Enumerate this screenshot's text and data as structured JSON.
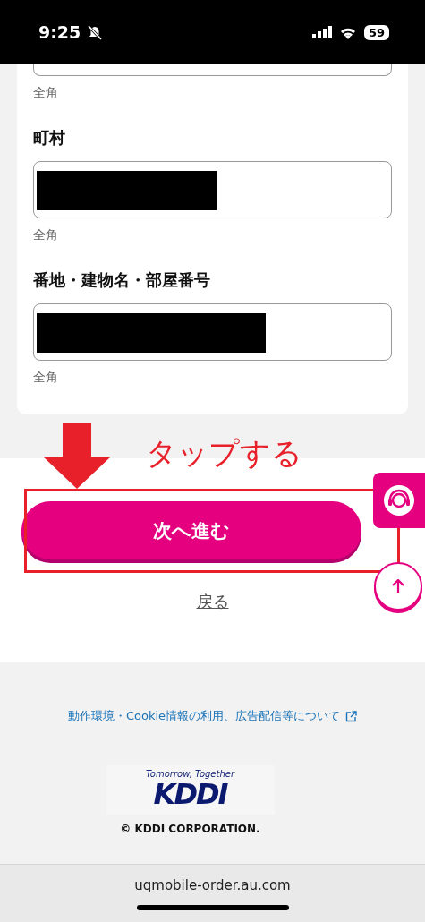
{
  "status_bar": {
    "time": "9:25",
    "battery": "59",
    "silent": true
  },
  "form": {
    "fields": [
      {
        "kind": "partial",
        "hint": "全角"
      },
      {
        "kind": "redacted",
        "label": "町村",
        "hint": "全角"
      },
      {
        "kind": "redacted",
        "label": "番地・建物名・部屋番号",
        "hint": "全角"
      }
    ]
  },
  "actions": {
    "primary_button": "次へ進む",
    "back_link": "戻る"
  },
  "annotation": {
    "text": "タップする"
  },
  "floating": {
    "support_button": true,
    "scroll_top_button": true
  },
  "footer": {
    "link": "動作環境・Cookie情報の利用、広告配信等について",
    "logo_tagline": "Tomorrow, Together",
    "logo": "KDDI",
    "copyright": "© KDDI CORPORATION."
  },
  "browser_bar": {
    "url": "uqmobile-order.au.com"
  }
}
